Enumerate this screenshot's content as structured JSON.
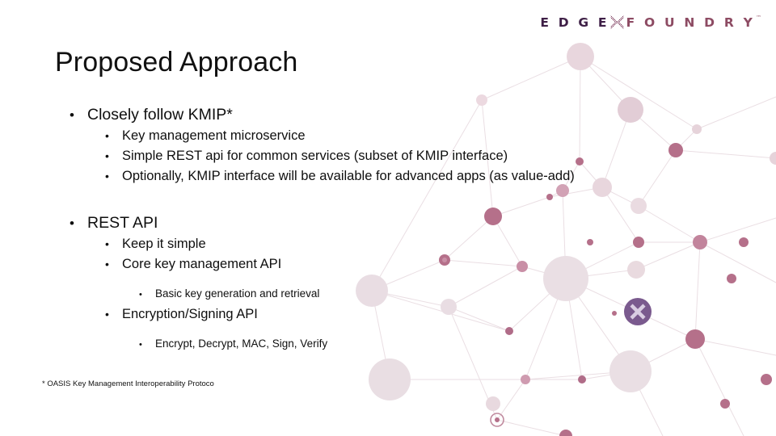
{
  "slide": {
    "title": "Proposed Approach",
    "footnote": "* OASIS Key Management Interoperability Protoco"
  },
  "logo": {
    "part1": "E D G E",
    "part2": "F O U N D R Y",
    "trademark": "™",
    "x_icon": "edgex-x-icon",
    "color_dark": "#3e1f46",
    "color_light": "#8d4b63"
  },
  "bullets": {
    "section1": {
      "heading": "Closely follow KMIP*",
      "items": [
        "Key management microservice",
        "Simple REST api for common services (subset of KMIP interface)",
        "Optionally, KMIP interface will be available for advanced apps (as value-add)"
      ]
    },
    "section2": {
      "heading": "REST API",
      "items": [
        "Keep it simple",
        "Core key management API"
      ],
      "sub_after_item2": "Basic key generation and retrieval",
      "item3": "Encryption/Signing API",
      "sub_after_item3": "Encrypt, Decrypt, MAC, Sign, Verify"
    }
  },
  "marks": {
    "bullet": "•"
  },
  "background": {
    "name": "network-constellation-graphic",
    "badge_letter": "X",
    "node_color_dark": "#b06c88",
    "node_color_mid": "#d7aabb",
    "node_color_light": "#ecdde3",
    "line_color": "#e9dde2",
    "badge_color": "#7a5a8e"
  }
}
